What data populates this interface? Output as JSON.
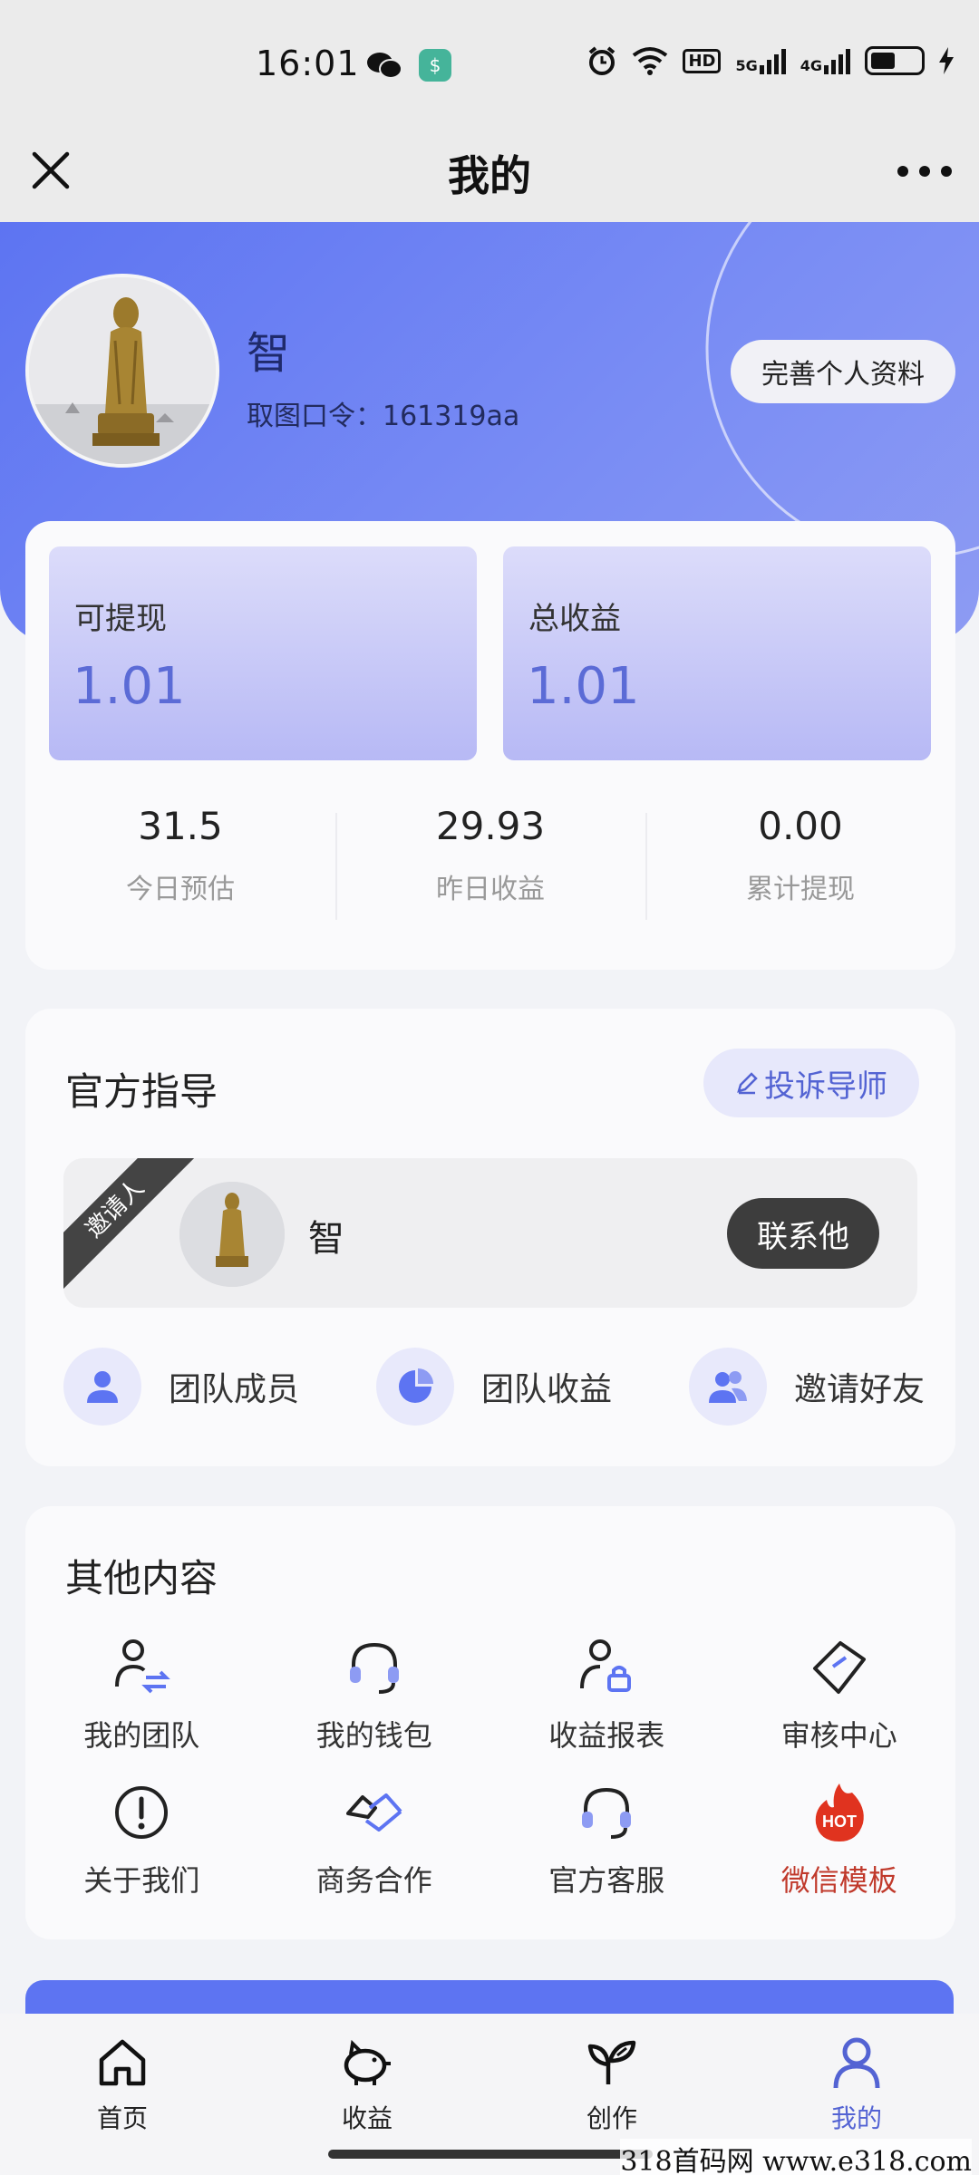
{
  "status_bar": {
    "time": "16:01",
    "hd_label": "HD",
    "signal1_label": "5G",
    "signal2_label": "4G"
  },
  "title_bar": {
    "title": "我的"
  },
  "profile": {
    "name": "智",
    "code_label": "取图口令：161319aa",
    "edit_button": "完善个人资料"
  },
  "earnings": {
    "withdrawable_label": "可提现",
    "withdrawable_value": "1.01",
    "total_label": "总收益",
    "total_value": "1.01",
    "stats": [
      {
        "value": "31.5",
        "label": "今日预估"
      },
      {
        "value": "29.93",
        "label": "昨日收益"
      },
      {
        "value": "0.00",
        "label": "累计提现"
      }
    ]
  },
  "guidance": {
    "title": "官方指导",
    "complain_button": "投诉导师",
    "ribbon": "邀请人",
    "inviter_name": "智",
    "contact_button": "联系他",
    "team": [
      {
        "label": "团队成员",
        "icon": "person-icon"
      },
      {
        "label": "团队收益",
        "icon": "pie-chart-icon"
      },
      {
        "label": "邀请好友",
        "icon": "people-icon"
      }
    ]
  },
  "other": {
    "title": "其他内容",
    "items": [
      {
        "label": "我的团队",
        "icon": "team-swap-icon"
      },
      {
        "label": "我的钱包",
        "icon": "headset-icon"
      },
      {
        "label": "收益报表",
        "icon": "user-lock-icon"
      },
      {
        "label": "审核中心",
        "icon": "tag-icon"
      },
      {
        "label": "关于我们",
        "icon": "info-icon"
      },
      {
        "label": "商务合作",
        "icon": "handshake-icon"
      },
      {
        "label": "官方客服",
        "icon": "headset-icon"
      },
      {
        "label": "微信模板",
        "icon": "hot-fire-icon",
        "hot_text": "HOT"
      }
    ]
  },
  "bottom_nav": [
    {
      "label": "首页",
      "icon": "home-icon"
    },
    {
      "label": "收益",
      "icon": "piggy-bank-icon"
    },
    {
      "label": "创作",
      "icon": "sprout-icon"
    },
    {
      "label": "我的",
      "icon": "user-icon",
      "active": true
    }
  ],
  "watermark": "318首码网 www.e318.com",
  "colors": {
    "accent": "#5d74f2",
    "accent_text": "#5363d3",
    "hot": "#e0331f"
  }
}
